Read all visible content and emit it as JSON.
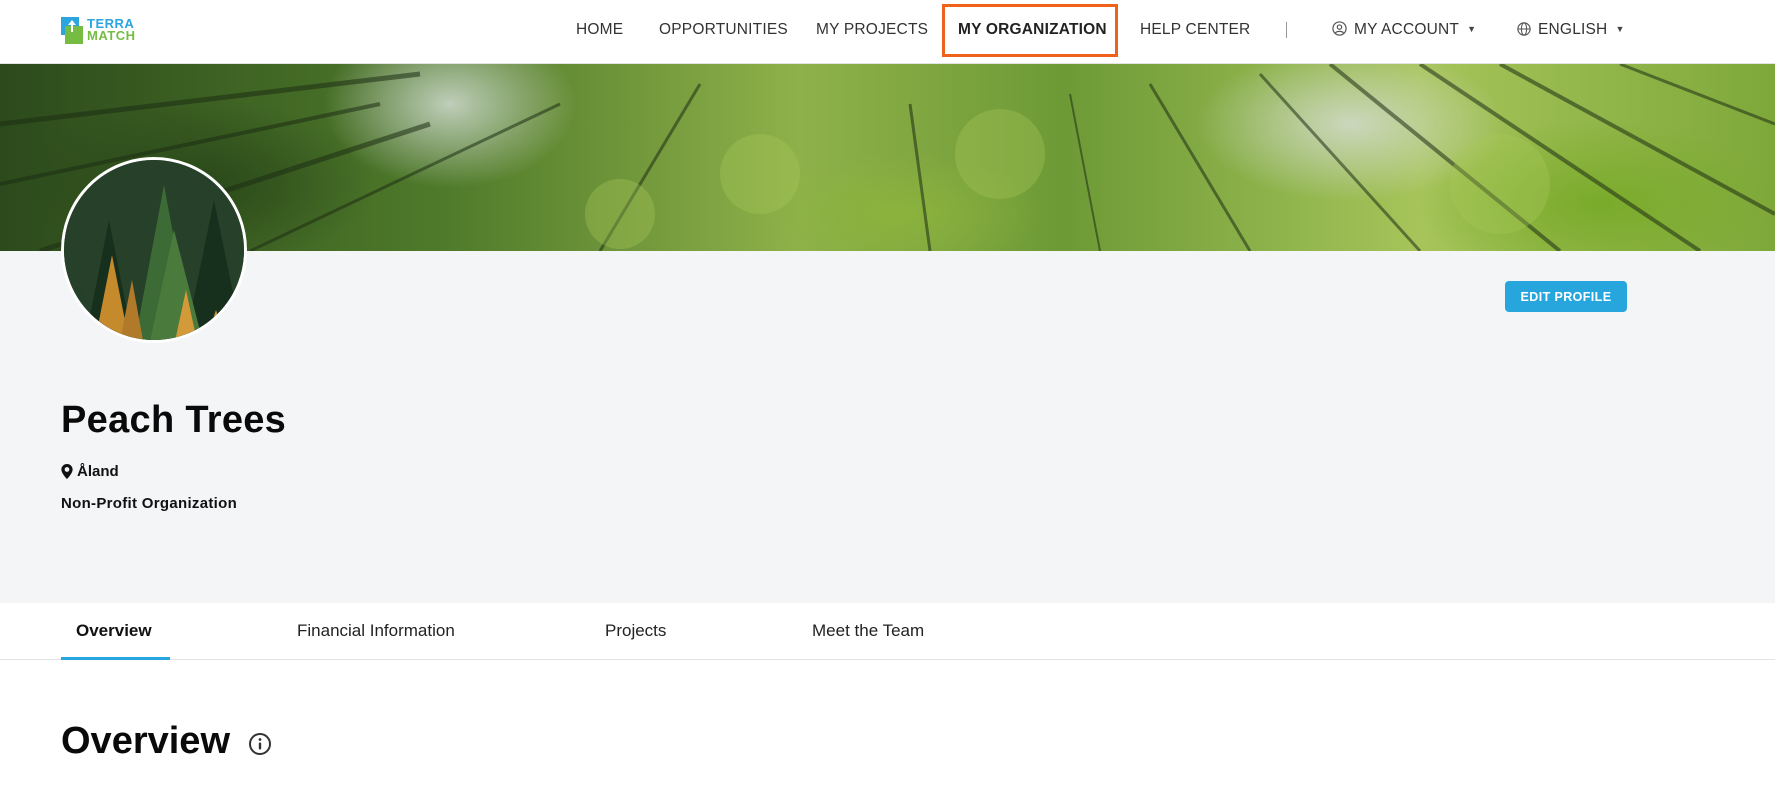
{
  "logo": {
    "line1": "TERRA",
    "line2": "MATCH"
  },
  "nav": {
    "home": "HOME",
    "opportunities": "OPPORTUNITIES",
    "my_projects": "MY PROJECTS",
    "my_organization": "MY ORGANIZATION",
    "help_center": "HELP CENTER",
    "my_account": "MY ACCOUNT",
    "language": "ENGLISH"
  },
  "profile": {
    "edit_button": "EDIT PROFILE",
    "name": "Peach Trees",
    "location": "Åland",
    "org_type": "Non-Profit Organization"
  },
  "tabs": [
    "Overview",
    "Financial Information",
    "Projects",
    "Meet the Team"
  ],
  "active_tab": "Overview",
  "section": {
    "title": "Overview"
  },
  "colors": {
    "accent": "#27a6de",
    "highlight": "#f0611a",
    "logo_blue": "#2aa5de",
    "logo_green": "#76bc43"
  }
}
